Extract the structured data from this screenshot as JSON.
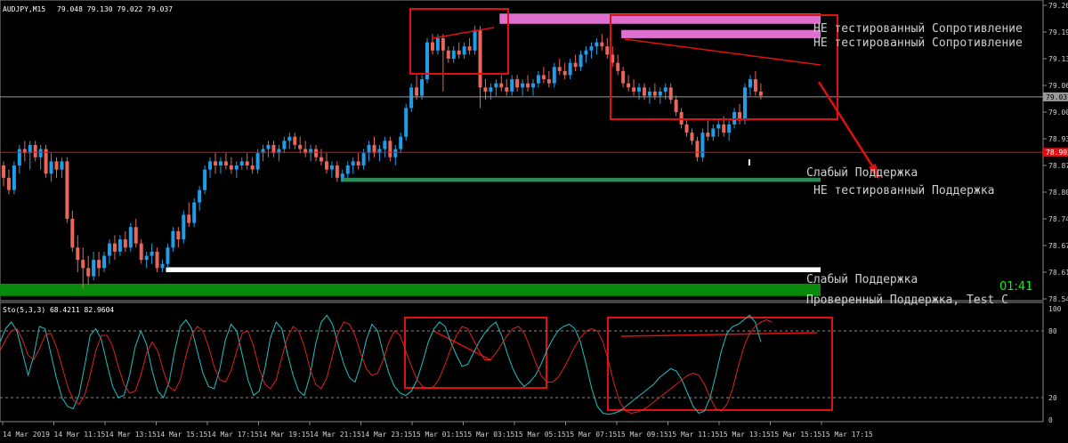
{
  "header": {
    "symbol_tf": "AUDJPY,M15",
    "ohlc": "79.048 79.130 79.022 79.037"
  },
  "colors": {
    "background": "#000000",
    "bull": "#1e9ee8",
    "bear": "#e8665a",
    "frame": "#e01010",
    "price_line": "#c8c8c8",
    "h_line": "#e01010",
    "resistance": "#e070d0",
    "support_green": "#2e8b57",
    "support_bright": "#0a8a0a",
    "support_white": "#ffffff",
    "stoch_main": "#20c0c0",
    "stoch_signal": "#e02020",
    "timer": "#00ff00"
  },
  "zone_labels": {
    "res1": "НЕ тестированный Сопротивление",
    "res2": "НЕ тестированный Сопротивление",
    "sup_weak_upper": "Слабый Поддержка",
    "sup_untested": "НЕ тестированный Поддержка",
    "sup_weak_lower": "Слабый Поддержка",
    "sup_proven": "Проверенный Поддержка, Test C"
  },
  "timer": "01:41",
  "current_price_label": "79.037",
  "hline_price_label": "78.902",
  "price_axis": [
    "79.260",
    "79.195",
    "79.130",
    "79.065",
    "79.000",
    "78.935",
    "78.870",
    "78.805",
    "78.740",
    "78.675",
    "78.610",
    "78.545"
  ],
  "time_axis": [
    "14 Mar 2019",
    "14 Mar 11:15",
    "14 Mar 13:15",
    "14 Mar 15:15",
    "14 Mar 17:15",
    "14 Mar 19:15",
    "14 Mar 21:15",
    "14 Mar 23:15",
    "15 Mar 01:15",
    "15 Mar 03:15",
    "15 Mar 05:15",
    "15 Mar 07:15",
    "15 Mar 09:15",
    "15 Mar 11:15",
    "15 Mar 13:15",
    "15 Mar 15:15",
    "15 Mar 17:15"
  ],
  "stoch": {
    "label": "Sto(5,3,3) 68.4211 82.9604",
    "levels": [
      "100",
      "80",
      "20",
      "0"
    ]
  },
  "chart_data": [
    {
      "type": "candlestick",
      "title": "AUDJPY,M15",
      "ylim": [
        78.545,
        79.26
      ],
      "hline": 78.902,
      "last_price": 79.037,
      "zones": [
        {
          "label": "НЕ тестированный Сопротивление",
          "from": 79.215,
          "to": 79.24,
          "start_candle": 94
        },
        {
          "label": "НЕ тестированный Сопротивление",
          "from": 79.18,
          "to": 79.2,
          "start_candle": 117
        },
        {
          "label": "Слабый Поддержка",
          "from": 78.87,
          "to": 78.885,
          "start_candle": 141
        },
        {
          "label": "НЕ тестированный Поддержка",
          "from": 78.83,
          "to": 78.84,
          "start_candle": 64
        },
        {
          "label": "Слабый Поддержка",
          "from": 78.61,
          "to": 78.622,
          "start_candle": 31
        },
        {
          "label": "Проверенный Поддержка, Test C",
          "from": 78.552,
          "to": 78.582,
          "start_candle": 0
        }
      ],
      "candles": [
        [
          78.87,
          78.88,
          78.82,
          78.84
        ],
        [
          78.84,
          78.86,
          78.8,
          78.81
        ],
        [
          78.81,
          78.88,
          78.8,
          78.87
        ],
        [
          78.87,
          78.92,
          78.85,
          78.91
        ],
        [
          78.91,
          78.93,
          78.88,
          78.9
        ],
        [
          78.9,
          78.93,
          78.86,
          78.92
        ],
        [
          78.92,
          78.93,
          78.88,
          78.89
        ],
        [
          78.89,
          78.92,
          78.86,
          78.91
        ],
        [
          78.91,
          78.92,
          78.84,
          78.85
        ],
        [
          78.85,
          78.9,
          78.83,
          78.88
        ],
        [
          78.88,
          78.89,
          78.84,
          78.86
        ],
        [
          78.86,
          78.89,
          78.84,
          78.88
        ],
        [
          78.88,
          78.89,
          78.73,
          78.74
        ],
        [
          78.74,
          78.76,
          78.66,
          78.67
        ],
        [
          78.67,
          78.7,
          78.61,
          78.64
        ],
        [
          78.64,
          78.67,
          78.57,
          78.62
        ],
        [
          78.62,
          78.65,
          78.58,
          78.6
        ],
        [
          78.6,
          78.66,
          78.59,
          78.64
        ],
        [
          78.64,
          78.66,
          78.6,
          78.62
        ],
        [
          78.62,
          78.66,
          78.61,
          78.65
        ],
        [
          78.65,
          78.69,
          78.63,
          78.68
        ],
        [
          78.68,
          78.7,
          78.64,
          78.66
        ],
        [
          78.66,
          78.7,
          78.65,
          78.69
        ],
        [
          78.69,
          78.71,
          78.66,
          78.67
        ],
        [
          78.67,
          78.73,
          78.66,
          78.72
        ],
        [
          78.72,
          78.74,
          78.67,
          78.68
        ],
        [
          78.68,
          78.69,
          78.63,
          78.64
        ],
        [
          78.64,
          78.66,
          78.62,
          78.65
        ],
        [
          78.65,
          78.68,
          78.63,
          78.66
        ],
        [
          78.66,
          78.67,
          78.61,
          78.62
        ],
        [
          78.62,
          78.64,
          78.61,
          78.63
        ],
        [
          78.63,
          78.68,
          78.62,
          78.67
        ],
        [
          78.67,
          78.72,
          78.66,
          78.71
        ],
        [
          78.71,
          78.72,
          78.67,
          78.69
        ],
        [
          78.69,
          78.76,
          78.68,
          78.75
        ],
        [
          78.75,
          78.78,
          78.72,
          78.73
        ],
        [
          78.73,
          78.79,
          78.72,
          78.78
        ],
        [
          78.78,
          78.82,
          78.76,
          78.81
        ],
        [
          78.81,
          78.87,
          78.8,
          78.86
        ],
        [
          78.86,
          78.89,
          78.84,
          78.88
        ],
        [
          78.88,
          78.9,
          78.85,
          78.87
        ],
        [
          78.87,
          78.89,
          78.85,
          78.88
        ],
        [
          78.88,
          78.9,
          78.86,
          78.87
        ],
        [
          78.87,
          78.89,
          78.85,
          78.86
        ],
        [
          78.86,
          78.88,
          78.84,
          78.87
        ],
        [
          78.87,
          78.89,
          78.86,
          78.88
        ],
        [
          78.88,
          78.9,
          78.86,
          78.87
        ],
        [
          78.87,
          78.89,
          78.85,
          78.86
        ],
        [
          78.86,
          78.91,
          78.85,
          78.9
        ],
        [
          78.9,
          78.92,
          78.88,
          78.91
        ],
        [
          78.91,
          78.93,
          78.89,
          78.92
        ],
        [
          78.92,
          78.93,
          78.89,
          78.9
        ],
        [
          78.9,
          78.92,
          78.88,
          78.91
        ],
        [
          78.91,
          78.94,
          78.9,
          78.93
        ],
        [
          78.93,
          78.95,
          78.91,
          78.94
        ],
        [
          78.94,
          78.95,
          78.91,
          78.92
        ],
        [
          78.92,
          78.94,
          78.9,
          78.91
        ],
        [
          78.91,
          78.93,
          78.89,
          78.9
        ],
        [
          78.9,
          78.92,
          78.88,
          78.91
        ],
        [
          78.91,
          78.92,
          78.88,
          78.89
        ],
        [
          78.89,
          78.91,
          78.87,
          78.88
        ],
        [
          78.88,
          78.9,
          78.85,
          78.86
        ],
        [
          78.86,
          78.88,
          78.84,
          78.87
        ],
        [
          78.87,
          78.88,
          78.83,
          78.84
        ],
        [
          78.84,
          78.86,
          78.83,
          78.85
        ],
        [
          78.85,
          78.88,
          78.84,
          78.87
        ],
        [
          78.87,
          78.89,
          78.85,
          78.88
        ],
        [
          78.88,
          78.9,
          78.86,
          78.87
        ],
        [
          78.87,
          78.91,
          78.86,
          78.9
        ],
        [
          78.9,
          78.93,
          78.88,
          78.92
        ],
        [
          78.92,
          78.94,
          78.89,
          78.9
        ],
        [
          78.9,
          78.92,
          78.88,
          78.91
        ],
        [
          78.91,
          78.94,
          78.89,
          78.93
        ],
        [
          78.93,
          78.94,
          78.88,
          78.89
        ],
        [
          78.89,
          78.92,
          78.87,
          78.91
        ],
        [
          78.91,
          78.95,
          78.9,
          78.94
        ],
        [
          78.94,
          79.02,
          78.93,
          79.01
        ],
        [
          79.01,
          79.07,
          79.0,
          79.06
        ],
        [
          79.06,
          79.09,
          79.03,
          79.04
        ],
        [
          79.04,
          79.09,
          79.03,
          79.08
        ],
        [
          79.08,
          79.18,
          79.07,
          79.17
        ],
        [
          79.17,
          79.19,
          79.14,
          79.15
        ],
        [
          79.15,
          79.19,
          79.14,
          79.18
        ],
        [
          79.18,
          79.19,
          79.05,
          79.15
        ],
        [
          79.15,
          79.16,
          79.12,
          79.13
        ],
        [
          79.13,
          79.16,
          79.12,
          79.15
        ],
        [
          79.15,
          79.17,
          79.13,
          79.14
        ],
        [
          79.14,
          79.17,
          79.13,
          79.16
        ],
        [
          79.16,
          79.18,
          79.14,
          79.15
        ],
        [
          79.15,
          79.21,
          79.14,
          79.2
        ],
        [
          79.2,
          79.21,
          79.01,
          79.06
        ],
        [
          79.06,
          79.08,
          79.03,
          79.05
        ],
        [
          79.05,
          79.07,
          79.03,
          79.06
        ],
        [
          79.06,
          79.08,
          79.04,
          79.07
        ],
        [
          79.07,
          79.09,
          79.05,
          79.06
        ],
        [
          79.06,
          79.08,
          79.04,
          79.05
        ],
        [
          79.05,
          79.09,
          79.04,
          79.08
        ],
        [
          79.08,
          79.09,
          79.05,
          79.06
        ],
        [
          79.06,
          79.08,
          79.04,
          79.07
        ],
        [
          79.07,
          79.09,
          79.05,
          79.06
        ],
        [
          79.06,
          79.08,
          79.04,
          79.07
        ],
        [
          79.07,
          79.1,
          79.06,
          79.09
        ],
        [
          79.09,
          79.11,
          79.07,
          79.08
        ],
        [
          79.08,
          79.1,
          79.06,
          79.07
        ],
        [
          79.07,
          79.12,
          79.06,
          79.11
        ],
        [
          79.11,
          79.13,
          79.09,
          79.1
        ],
        [
          79.1,
          79.12,
          79.08,
          79.09
        ],
        [
          79.09,
          79.13,
          79.08,
          79.12
        ],
        [
          79.12,
          79.14,
          79.1,
          79.11
        ],
        [
          79.11,
          79.15,
          79.1,
          79.14
        ],
        [
          79.14,
          79.16,
          79.12,
          79.15
        ],
        [
          79.15,
          79.17,
          79.13,
          79.16
        ],
        [
          79.16,
          79.18,
          79.14,
          79.17
        ],
        [
          79.17,
          79.19,
          79.15,
          79.16
        ],
        [
          79.16,
          79.18,
          79.13,
          79.14
        ],
        [
          79.14,
          79.16,
          79.11,
          79.12
        ],
        [
          79.12,
          79.14,
          79.09,
          79.1
        ],
        [
          79.1,
          79.11,
          79.06,
          79.07
        ],
        [
          79.07,
          79.09,
          79.05,
          79.06
        ],
        [
          79.06,
          79.08,
          79.04,
          79.05
        ],
        [
          79.05,
          79.07,
          79.03,
          79.06
        ],
        [
          79.06,
          79.07,
          79.03,
          79.04
        ],
        [
          79.04,
          79.06,
          79.02,
          79.05
        ],
        [
          79.05,
          79.07,
          79.03,
          79.04
        ],
        [
          79.04,
          79.06,
          79.02,
          79.05
        ],
        [
          79.05,
          79.07,
          79.03,
          79.06
        ],
        [
          79.06,
          79.07,
          79.02,
          79.03
        ],
        [
          79.03,
          79.04,
          78.99,
          79.0
        ],
        [
          79.0,
          79.01,
          78.96,
          78.97
        ],
        [
          78.97,
          78.98,
          78.94,
          78.95
        ],
        [
          78.95,
          78.96,
          78.92,
          78.93
        ],
        [
          78.93,
          78.94,
          78.88,
          78.89
        ],
        [
          78.89,
          78.96,
          78.88,
          78.95
        ],
        [
          78.95,
          78.98,
          78.93,
          78.94
        ],
        [
          78.94,
          78.97,
          78.93,
          78.96
        ],
        [
          78.96,
          78.98,
          78.94,
          78.97
        ],
        [
          78.97,
          78.99,
          78.94,
          78.95
        ],
        [
          78.95,
          78.98,
          78.93,
          78.97
        ],
        [
          78.97,
          79.01,
          78.96,
          79.0
        ],
        [
          79.0,
          79.02,
          78.97,
          78.98
        ],
        [
          78.98,
          79.07,
          78.97,
          79.06
        ],
        [
          79.06,
          79.09,
          79.04,
          79.08
        ],
        [
          79.08,
          79.1,
          79.04,
          79.05
        ],
        [
          79.05,
          79.07,
          79.03,
          79.04
        ]
      ]
    },
    {
      "type": "line",
      "title": "Sto(5,3,3) 68.4211 82.9604",
      "ylim": [
        0,
        100
      ],
      "levels": [
        80,
        20
      ],
      "series": [
        {
          "values": [
            70,
            82,
            88,
            80,
            60,
            40,
            58,
            84,
            82,
            60,
            38,
            20,
            12,
            10,
            22,
            48,
            76,
            82,
            72,
            50,
            30,
            20,
            22,
            40,
            66,
            80,
            68,
            44,
            26,
            20,
            34,
            62,
            84,
            90,
            82,
            62,
            42,
            30,
            28,
            46,
            72,
            86,
            80,
            58,
            36,
            22,
            26,
            46,
            74,
            88,
            82,
            60,
            40,
            26,
            22,
            40,
            68,
            88,
            94,
            86,
            68,
            50,
            38,
            34,
            50,
            72,
            86,
            80,
            60,
            42,
            30,
            24,
            22,
            26,
            36,
            52,
            70,
            82,
            88,
            84,
            70,
            58,
            48,
            50,
            60,
            70,
            78,
            84,
            88,
            76,
            60,
            46,
            36,
            30,
            34,
            40,
            50,
            62,
            72,
            80,
            84,
            86,
            82,
            70,
            50,
            28,
            12,
            6,
            5,
            6,
            8,
            12,
            16,
            20,
            24,
            28,
            32,
            38,
            42,
            46,
            44,
            36,
            24,
            12,
            6,
            8,
            20,
            40,
            62,
            78,
            84,
            86,
            90,
            94,
            88,
            70
          ]
        },
        {
          "values": [
            62,
            72,
            80,
            82,
            72,
            58,
            54,
            64,
            76,
            78,
            66,
            48,
            30,
            18,
            14,
            22,
            40,
            62,
            76,
            76,
            66,
            48,
            32,
            24,
            26,
            40,
            60,
            70,
            62,
            44,
            30,
            26,
            36,
            58,
            76,
            84,
            80,
            66,
            48,
            36,
            34,
            44,
            62,
            78,
            80,
            66,
            46,
            32,
            28,
            36,
            56,
            74,
            84,
            80,
            66,
            46,
            32,
            28,
            38,
            58,
            78,
            88,
            86,
            76,
            60,
            46,
            40,
            42,
            54,
            70,
            80,
            76,
            62,
            48,
            36,
            30,
            28,
            30,
            38,
            50,
            64,
            76,
            84,
            82,
            72,
            62,
            54,
            54,
            60,
            68,
            76,
            82,
            84,
            78,
            66,
            52,
            40,
            34,
            34,
            38,
            46,
            56,
            66,
            74,
            80,
            82,
            80,
            70,
            52,
            32,
            16,
            8,
            6,
            7,
            9,
            12,
            16,
            20,
            24,
            28,
            32,
            36,
            40,
            42,
            40,
            32,
            20,
            10,
            8,
            14,
            28,
            48,
            66,
            78,
            84,
            88,
            90,
            88
          ]
        }
      ]
    }
  ]
}
